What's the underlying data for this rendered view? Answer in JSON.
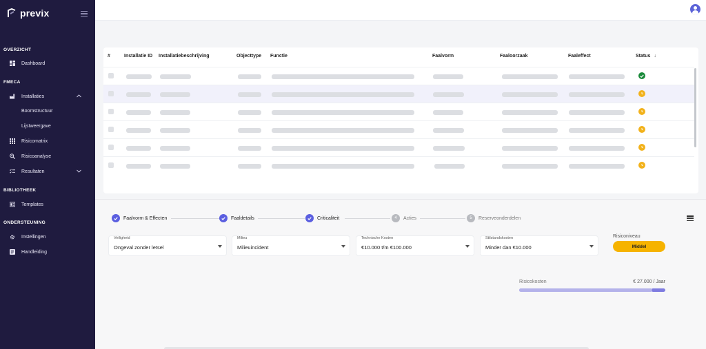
{
  "app": {
    "brand": "previx"
  },
  "sidebar": {
    "sections": [
      {
        "title": "OVERZICHT",
        "items": [
          {
            "label": "Dashboard",
            "icon": "dashboard-icon"
          }
        ]
      },
      {
        "title": "FMECA",
        "items": [
          {
            "label": "Installaties",
            "icon": "factory-icon",
            "expanded": true
          },
          {
            "label": "Boomstructuur",
            "sub": true
          },
          {
            "label": "Lijstweergave",
            "sub": true
          },
          {
            "label": "Risicomatrix",
            "icon": "grid-icon"
          },
          {
            "label": "Risicoanalyse",
            "icon": "zoom-analysis-icon"
          },
          {
            "label": "Resultaten",
            "icon": "checklist-icon",
            "expandable": true
          }
        ]
      },
      {
        "title": "BIBLIOTHEEK",
        "items": [
          {
            "label": "Templates",
            "icon": "templates-icon"
          }
        ]
      },
      {
        "title": "ONDERSTEUNING",
        "items": [
          {
            "label": "Instellingen",
            "icon": "gear-icon"
          },
          {
            "label": "Handleiding",
            "icon": "manual-icon"
          }
        ]
      }
    ]
  },
  "table": {
    "columns": [
      "#",
      "Installatie ID",
      "Installatiebeschrijving",
      "Objecttype",
      "Functie",
      "Faalvorm",
      "Faaloorzaak",
      "Faaleffect",
      "Status"
    ],
    "sort_indicator": "↓",
    "rows": [
      {
        "status": "done",
        "highlight": false
      },
      {
        "status": "pending",
        "highlight": true
      },
      {
        "status": "pending",
        "highlight": false
      },
      {
        "status": "pending",
        "highlight": false
      },
      {
        "status": "pending",
        "highlight": false
      },
      {
        "status": "pending",
        "highlight": false
      }
    ]
  },
  "wizard": {
    "steps": [
      {
        "label": "Faalvorm & Effecten",
        "state": "done",
        "num": "1"
      },
      {
        "label": "Faaldetails",
        "state": "done",
        "num": "2"
      },
      {
        "label": "Criticaliteit",
        "state": "done",
        "num": "3"
      },
      {
        "label": "Acties",
        "state": "todo",
        "num": "4"
      },
      {
        "label": "Reserveonderdelen",
        "state": "todo",
        "num": "5"
      }
    ]
  },
  "fields": {
    "veiligheid": {
      "label": "Veiligheid",
      "value": "Ongeval zonder letsel"
    },
    "milieu": {
      "label": "Milieu",
      "value": "Milieuincident"
    },
    "technische": {
      "label": "Technische Kosten",
      "value": "€10.000 t/m €100.000"
    },
    "stilstand": {
      "label": "Stilstandskosten",
      "value": "Minder dan €10.000"
    }
  },
  "risk": {
    "label": "Risiconiveau",
    "value": "Middel",
    "color": "#f6b300"
  },
  "cost": {
    "label": "Risicokosten",
    "value": "€ 27.000 / Jaar",
    "fill_fraction": 0.9
  },
  "colors": {
    "sidebar": "#1f1b3f",
    "accent": "#5b5fe0",
    "ok": "#1a8a3a",
    "pending": "#f2b21b"
  }
}
